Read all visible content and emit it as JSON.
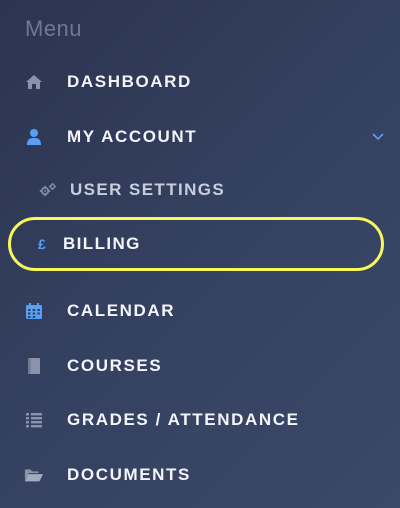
{
  "menu": {
    "title": "Menu",
    "items": [
      {
        "label": "DASHBOARD",
        "icon": "home-icon"
      },
      {
        "label": "MY ACCOUNT",
        "icon": "user-icon",
        "expanded": true
      },
      {
        "label": "USER SETTINGS",
        "icon": "cogs-icon"
      },
      {
        "label": "BILLING",
        "icon": "pound-icon",
        "icon_glyph": "£",
        "highlighted": true
      },
      {
        "label": "CALENDAR",
        "icon": "calendar-icon"
      },
      {
        "label": "COURSES",
        "icon": "book-icon"
      },
      {
        "label": "GRADES / ATTENDANCE",
        "icon": "list-icon"
      },
      {
        "label": "DOCUMENTS",
        "icon": "folder-open-icon"
      }
    ]
  },
  "colors": {
    "background_start": "#2b3450",
    "background_end": "#3b4868",
    "label_text": "#f3f5fa",
    "icon_muted": "#8a93a9",
    "accent_blue": "#5a9ff6",
    "highlight_outline": "#f7f85a"
  }
}
